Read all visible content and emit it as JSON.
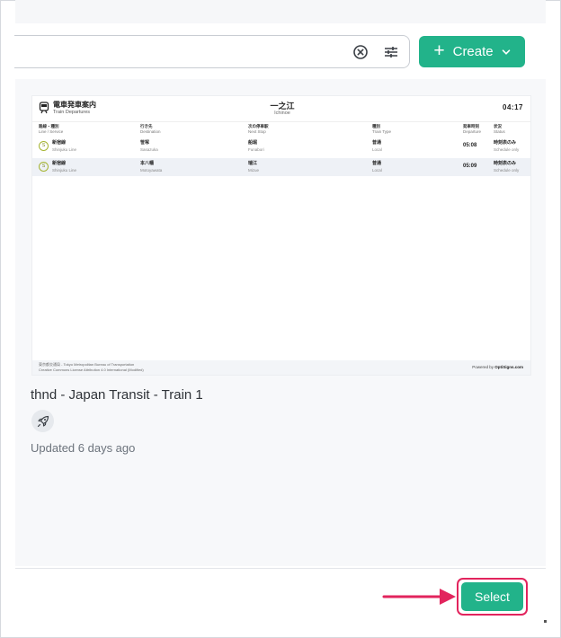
{
  "toolbar": {
    "create_label": "Create"
  },
  "card": {
    "title": "thnd - Japan Transit - Train 1",
    "updated": "Updated 6 days ago"
  },
  "preview": {
    "title_jp": "電車発車案内",
    "title_en": "Train Departures",
    "station_jp": "一之江",
    "station_en": "Ichinoe",
    "clock": "04:17",
    "columns": [
      {
        "jp": "路線・種別",
        "en": "Line / Service"
      },
      {
        "jp": "行き先",
        "en": "Destination"
      },
      {
        "jp": "次の停車駅",
        "en": "Next Stop"
      },
      {
        "jp": "種別",
        "en": "Train Type"
      },
      {
        "jp": "発車時刻",
        "en": "Departure"
      },
      {
        "jp": "状況",
        "en": "Status"
      }
    ],
    "rows": [
      {
        "badge": "S",
        "line_jp": "新宿線",
        "line_en": "Shinjuku Line",
        "dest_jp": "笹塚",
        "dest_en": "Sasazuka",
        "next_jp": "船堀",
        "next_en": "Funabori",
        "type_jp": "普通",
        "type_en": "Local",
        "time": "05:08",
        "status_jp": "時刻表のみ",
        "status_en": "Schedule only"
      },
      {
        "badge": "S",
        "line_jp": "新宿線",
        "line_en": "Shinjuku Line",
        "dest_jp": "本八幡",
        "dest_en": "Motoyawata",
        "next_jp": "瑞江",
        "next_en": "Mizue",
        "type_jp": "普通",
        "type_en": "Local",
        "time": "05:09",
        "status_jp": "時刻表のみ",
        "status_en": "Schedule only"
      }
    ],
    "credit_1": "東京都交通局 - Tokyo Metropolitan Bureau of Transportation",
    "credit_2": "Creative Commons License Attribution 4.0 International (Modified)",
    "powered_prefix": "Powered by",
    "powered_brand": "OptiSigns.com"
  },
  "footer": {
    "select_label": "Select"
  },
  "colors": {
    "accent": "#22b38a",
    "highlight": "#e2245d"
  }
}
